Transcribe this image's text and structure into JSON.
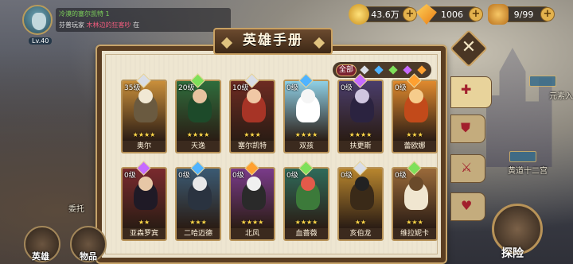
{
  "top": {
    "player": {
      "level": "Lv.40"
    },
    "chat": {
      "line1_name": "冷漠的塞尔凯特 1",
      "line2_player": "芬普玩家",
      "line2_highlight": "木林边的狂客吵",
      "line2_suffix": "在"
    },
    "currencies": [
      {
        "name": "gold",
        "value": "43.6万",
        "color": "#f3c443"
      },
      {
        "name": "diamond",
        "value": "1006",
        "color": "#ffb02e"
      },
      {
        "name": "stamina",
        "value": "9/99",
        "color": "#e8a33a"
      }
    ]
  },
  "panel": {
    "title": "英雄手册",
    "close_icon": "close-icon",
    "filters": {
      "all_label": "全部",
      "gems": [
        {
          "name": "white-gem-icon",
          "color": "#d9dde6"
        },
        {
          "name": "blue-gem-icon",
          "color": "#4fb3ff"
        },
        {
          "name": "green-gem-icon",
          "color": "#7ee05a"
        },
        {
          "name": "purple-gem-icon",
          "color": "#c66bff"
        },
        {
          "name": "orange-gem-icon",
          "color": "#ffa030"
        }
      ]
    },
    "side_tabs": [
      {
        "name": "all-tab-icon",
        "glyph": "✚",
        "active": true
      },
      {
        "name": "shield-tab-icon",
        "glyph": "⛊",
        "active": false
      },
      {
        "name": "sword-tab-icon",
        "glyph": "⚔",
        "active": false
      },
      {
        "name": "heart-tab-icon",
        "glyph": "♥",
        "active": false
      }
    ],
    "heroes": [
      {
        "level": "35级",
        "name": "奥尔",
        "stars": "★★★★",
        "elem": "#d9dde6",
        "bg": "#c98f3b",
        "body": "#6a5a40",
        "head": "#f1e8d4"
      },
      {
        "level": "20级",
        "name": "天逸",
        "stars": "★★★★",
        "elem": "#7ee05a",
        "bg": "#2f6d3c",
        "body": "#1d4a2a",
        "head": "#e7c3a0"
      },
      {
        "level": "10级",
        "name": "塞尔凯特",
        "stars": "★★★",
        "elem": "#d9dde6",
        "bg": "#6d2b22",
        "body": "#a73426",
        "head": "#f0c8a5"
      },
      {
        "level": "0级",
        "name": "双孩",
        "stars": "★★★★",
        "elem": "#4fb3ff",
        "bg": "#8fd0e6",
        "body": "#ffffff",
        "head": "#f5f5f5"
      },
      {
        "level": "0级",
        "name": "扶更斯",
        "stars": "★★★★",
        "elem": "#c66bff",
        "bg": "#4a3d6b",
        "body": "#2b2340",
        "head": "#d0c6e0"
      },
      {
        "level": "0级",
        "name": "蕾欧娜",
        "stars": "★★★",
        "elem": "#ffa030",
        "bg": "#e08a2e",
        "body": "#c24a1a",
        "head": "#f6cc8c"
      },
      {
        "level": "0级",
        "name": "亚森罗宾",
        "stars": "★★",
        "elem": "#c66bff",
        "bg": "#7a2a2e",
        "body": "#1f1a26",
        "head": "#e7c7a6"
      },
      {
        "level": "0级",
        "name": "二哈迈德",
        "stars": "★★★",
        "elem": "#4fb3ff",
        "bg": "#3b5a73",
        "body": "#2a3340",
        "head": "#e8e8e8"
      },
      {
        "level": "0级",
        "name": "北风",
        "stars": "★★★★",
        "elem": "#ffa030",
        "bg": "#7a3b8a",
        "body": "#2a2a2a",
        "head": "#f0f0f0"
      },
      {
        "level": "0级",
        "name": "血蔷薇",
        "stars": "★★★★",
        "elem": "#7ee05a",
        "bg": "#2f6b5a",
        "body": "#3c7a3a",
        "head": "#e25a4a"
      },
      {
        "level": "0级",
        "name": "亥伯龙",
        "stars": "★★",
        "elem": "#d9dde6",
        "bg": "#b8862e",
        "body": "#3a2a18",
        "head": "#222222"
      },
      {
        "level": "0级",
        "name": "维拉妮卡",
        "stars": "★★★",
        "elem": "#7ee05a",
        "bg": "#9a6a3a",
        "body": "#f0e6d0",
        "head": "#6a4a2a"
      }
    ]
  },
  "bg_labels": {
    "zodiac": "黄道十二宫",
    "tower": "元素入",
    "commission": "委托"
  },
  "bottom_nav": [
    {
      "label": "英雄"
    },
    {
      "label": "物品"
    }
  ],
  "explore": {
    "label": "探险"
  }
}
